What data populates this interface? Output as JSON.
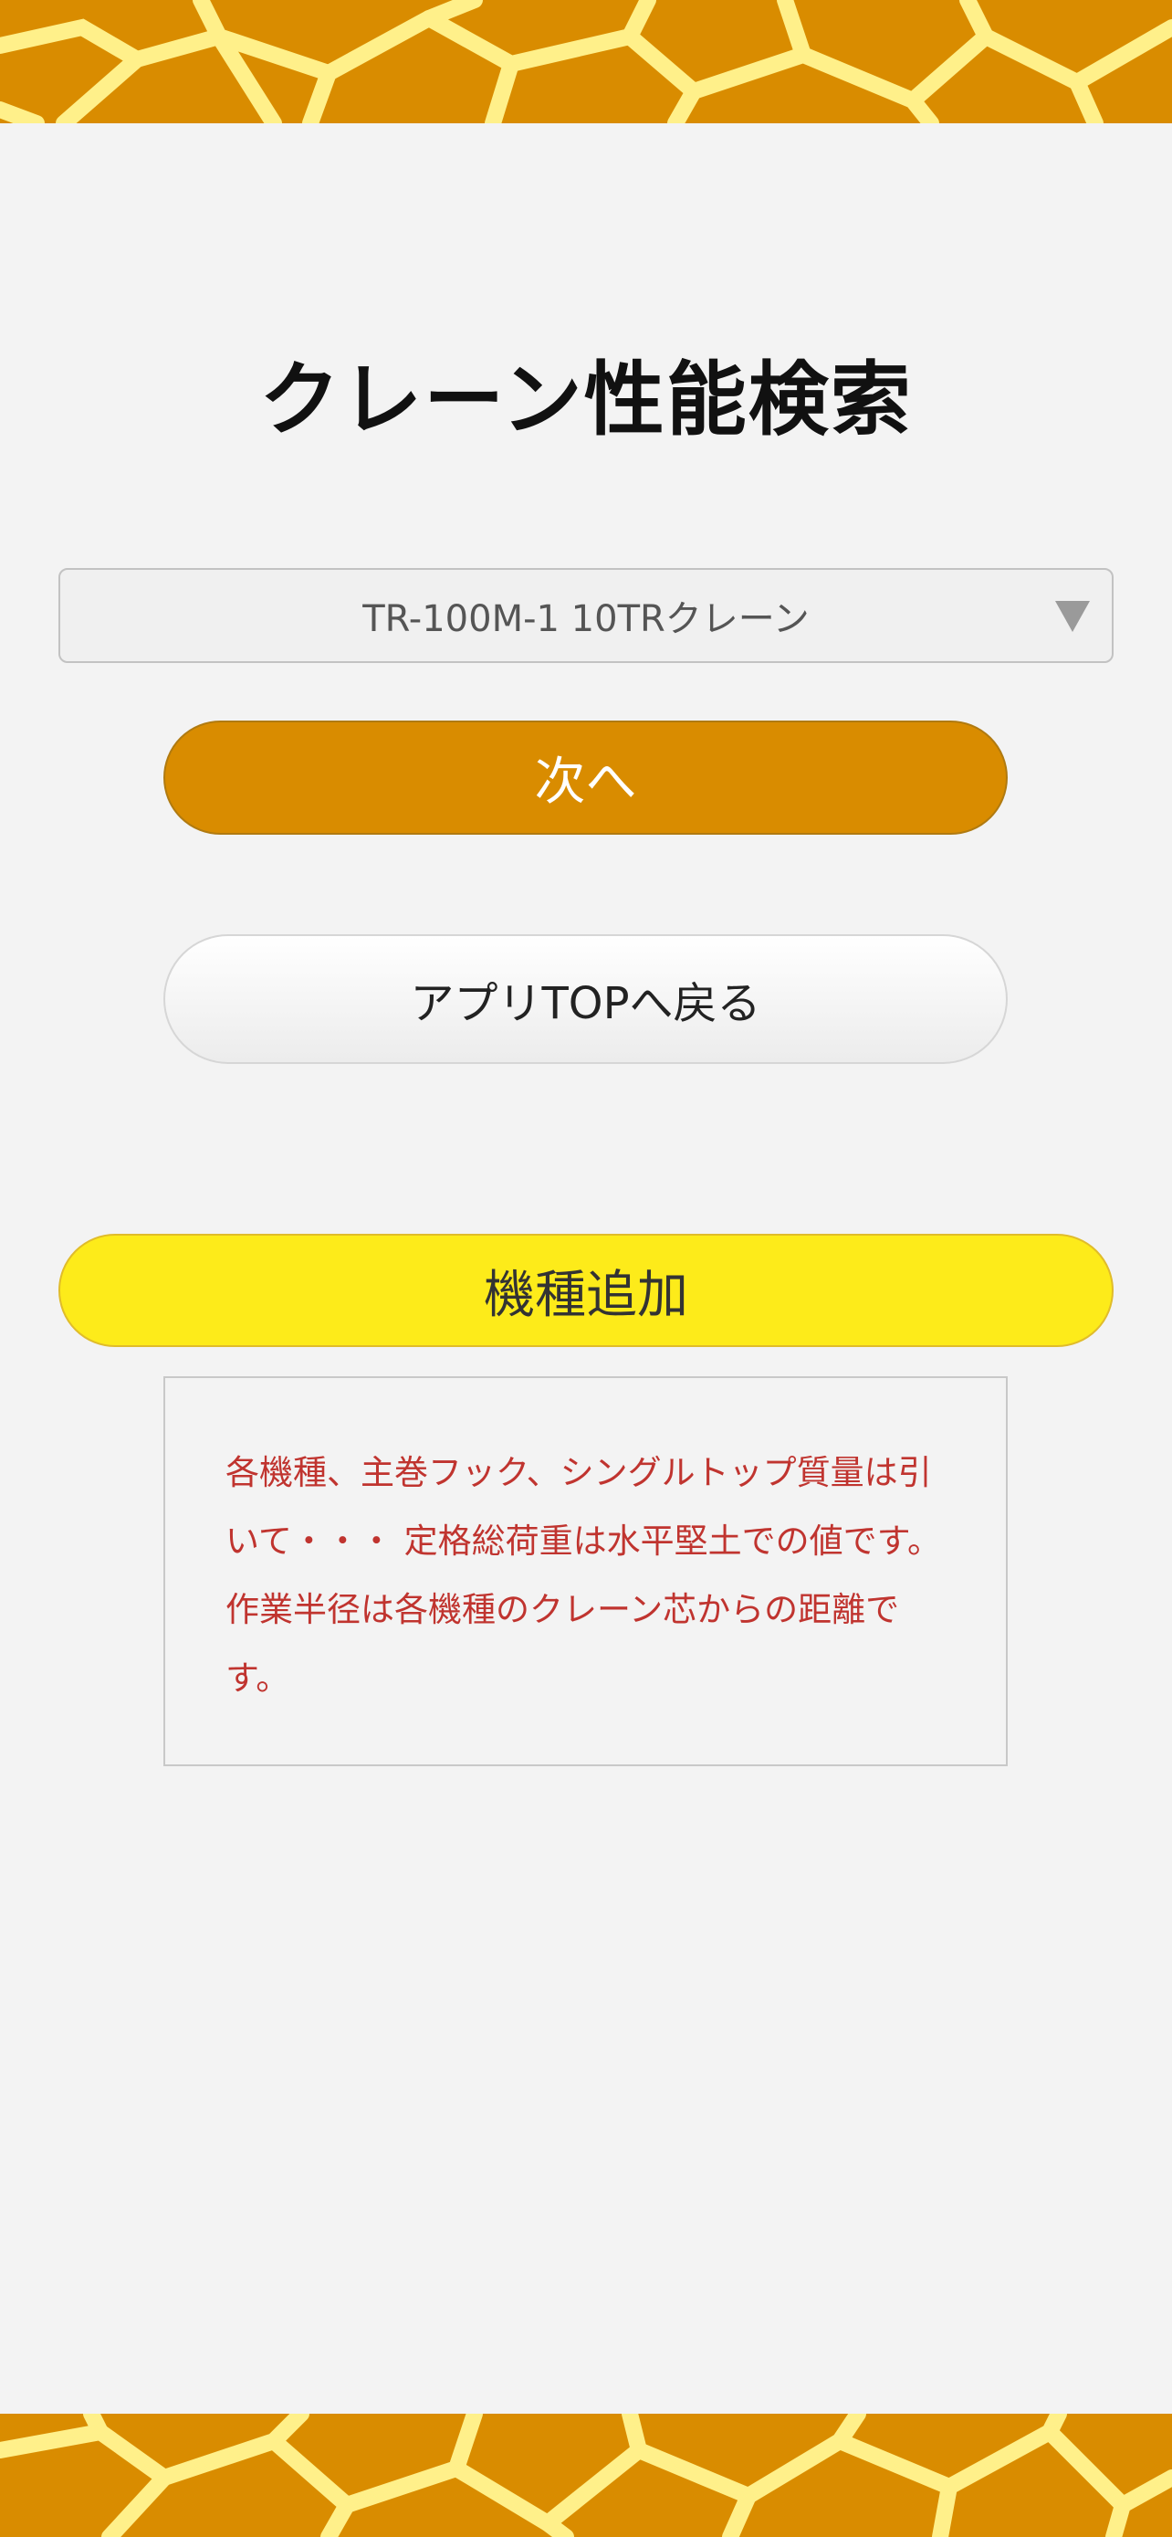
{
  "colors": {
    "background": "#f3f3f3",
    "banner_orange": "#d98c00",
    "banner_pattern": "#fff08a",
    "next_button": "#d98c00",
    "add_button": "#fdeb1a",
    "notice_text": "#c0342f"
  },
  "header": {
    "title": "クレーン性能検索"
  },
  "model_select": {
    "selected": "TR-100M-1 10TRクレーン",
    "caret_icon": "triangle-down-icon"
  },
  "buttons": {
    "next_label": "次へ",
    "back_label": "アプリTOPへ戻る",
    "add_label": "機種追加"
  },
  "notice": {
    "text": "各機種、主巻フック、シングルトップ質量は引いて・・・ 定格総荷重は水平堅土での値です。作業半径は各機種のクレーン芯からの距離です。"
  }
}
